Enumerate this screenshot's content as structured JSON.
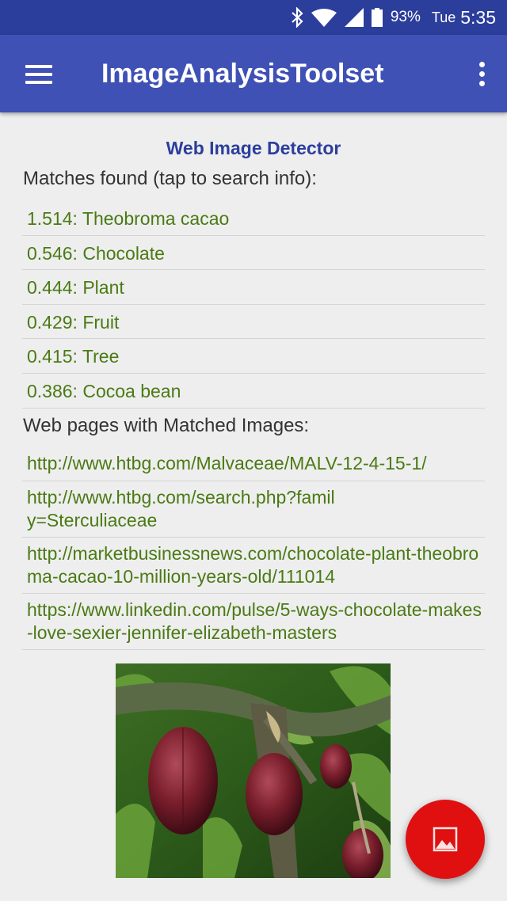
{
  "status_bar": {
    "battery": "93%",
    "day": "Tue",
    "time": "5:35"
  },
  "app_bar": {
    "title": "ImageAnalysisToolset"
  },
  "content": {
    "section_title": "Web Image Detector",
    "matches_heading": "Matches found (tap to search info):",
    "matches": [
      "1.514: Theobroma cacao",
      "0.546: Chocolate",
      "0.444: Plant",
      "0.429: Fruit",
      "0.415: Tree",
      "0.386: Cocoa bean"
    ],
    "pages_heading": "Web pages with Matched Images:",
    "pages": [
      "http://www.htbg.com/Malvaceae/MALV-12-4-15-1/",
      "http://www.htbg.com/search.php?family=Sterculiaceae",
      "http://marketbusinessnews.com/chocolate-plant-theobroma-cacao-10-million-years-old/111014",
      "https://www.linkedin.com/pulse/5-ways-chocolate-makes-love-sexier-jennifer-elizabeth-masters"
    ]
  },
  "colors": {
    "status_bar": "#2c3e9c",
    "app_bar": "#3f51b5",
    "link_green": "#4a7a14",
    "fab": "#e01010"
  },
  "icons": {
    "menu": "menu-icon",
    "overflow": "more-vert-icon",
    "fab": "image-icon"
  }
}
